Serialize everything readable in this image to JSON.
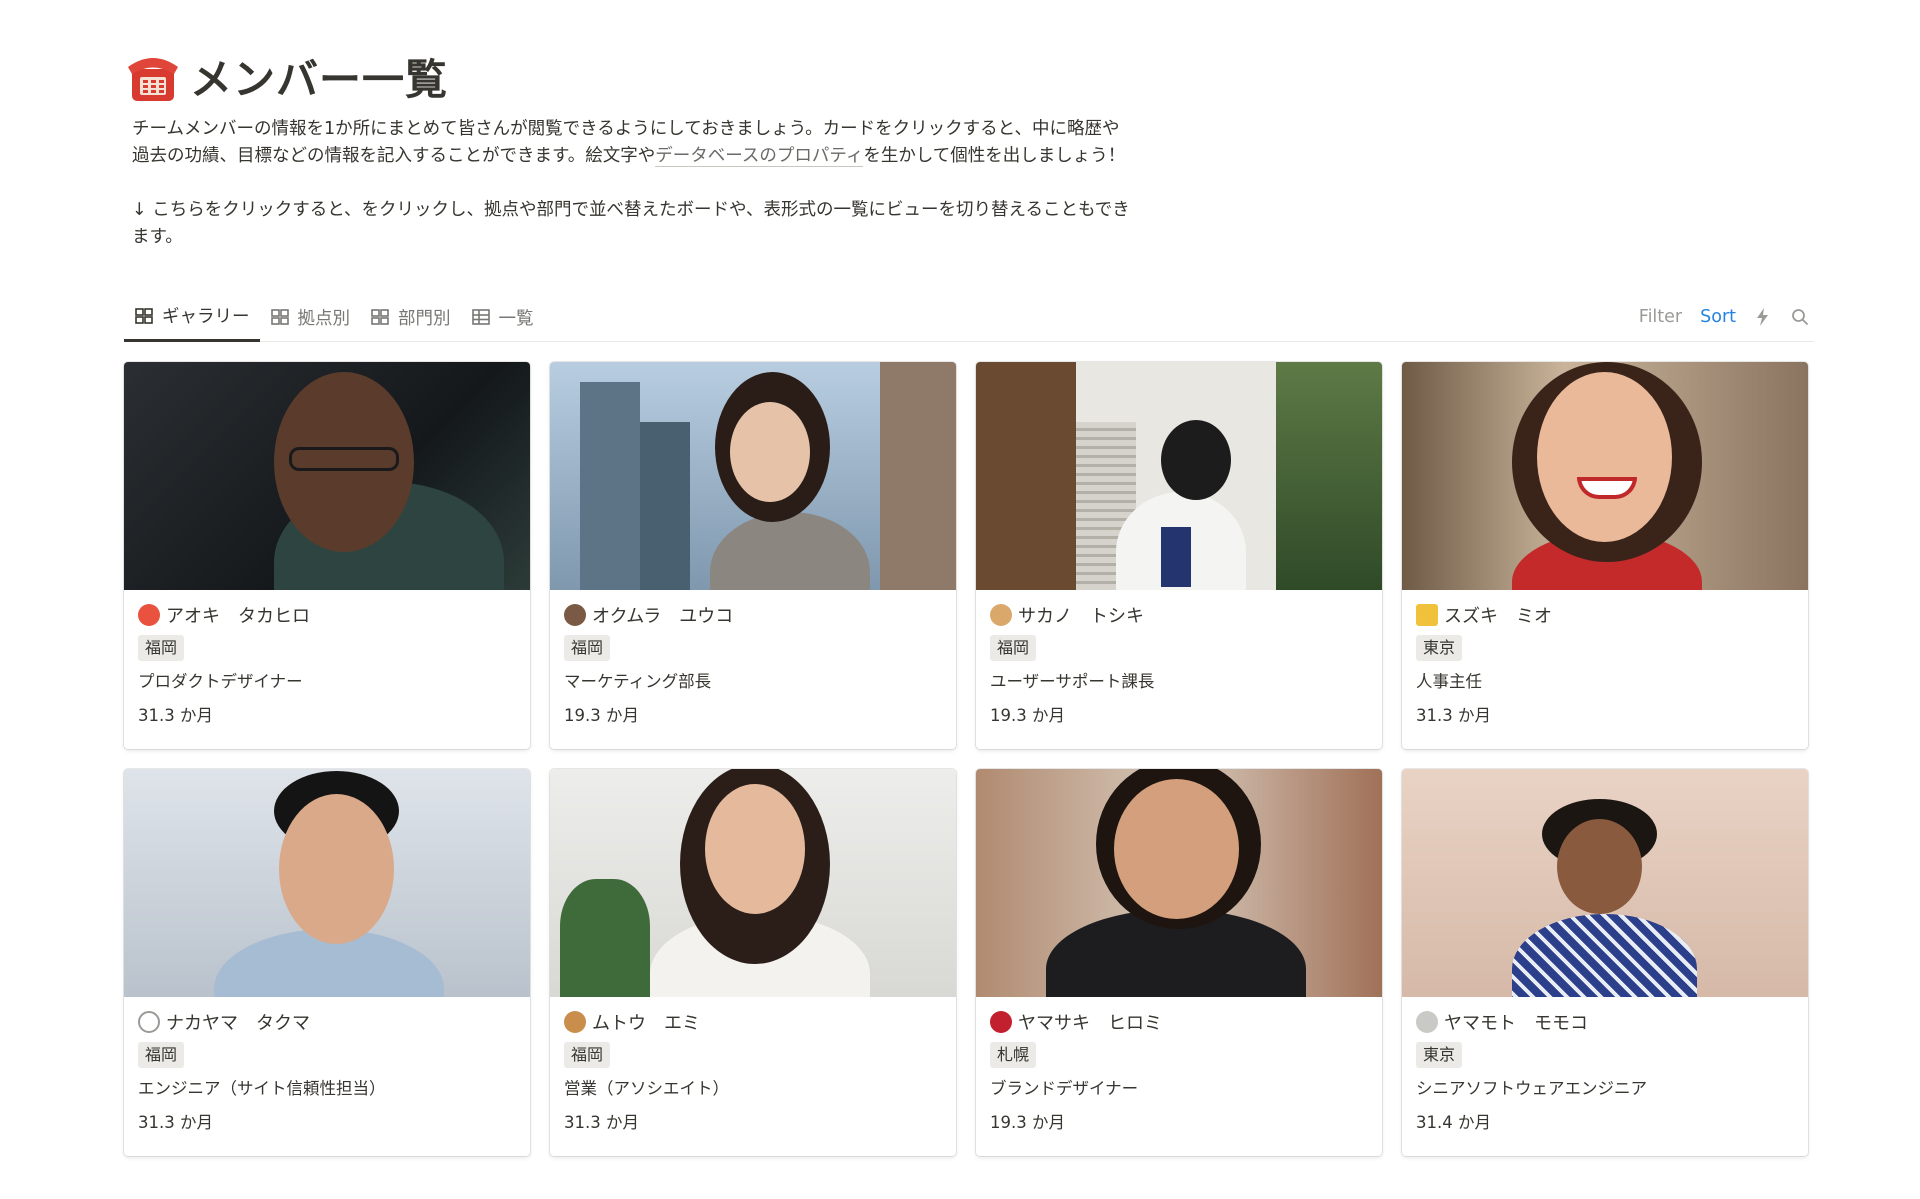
{
  "page": {
    "icon": "telephone-icon",
    "title": "メンバー一覧",
    "description_1_before": "チームメンバーの情報を1か所にまとめて皆さんが閲覧できるようにしておきましょう。カードをクリックすると、中に略歴や過去の功績、目標などの情報を記入することができます。絵文字や",
    "description_1_link": "データベースのプロパティ",
    "description_1_after": "を生かして個性を出しましょう！",
    "description_2": "↓ こちらをクリックすると、をクリックし、拠点や部門で並べ替えたボードや、表形式の一覧にビューを切り替えることもできます。"
  },
  "views": {
    "tabs": [
      {
        "label": "ギャラリー",
        "icon": "gallery-icon",
        "active": true
      },
      {
        "label": "拠点別",
        "icon": "gallery-icon",
        "active": false
      },
      {
        "label": "部門別",
        "icon": "gallery-icon",
        "active": false
      },
      {
        "label": "一覧",
        "icon": "table-icon",
        "active": false
      }
    ],
    "filter_label": "Filter",
    "sort_label": "Sort",
    "automation_icon": "lightning-icon",
    "search_icon": "search-icon"
  },
  "members": [
    {
      "emoji": "ping-pong-icon",
      "name": "アオキ　タカヒロ",
      "location": "福岡",
      "role": "プロダクトデザイナー",
      "tenure": "31.3 か月"
    },
    {
      "emoji": "bear-icon",
      "name": "オクムラ　ユウコ",
      "location": "福岡",
      "role": "マーケティング部長",
      "tenure": "19.3 か月"
    },
    {
      "emoji": "dog-icon",
      "name": "サカノ　トシキ",
      "location": "福岡",
      "role": "ユーザーサポート課長",
      "tenure": "19.3 か月"
    },
    {
      "emoji": "crown-icon",
      "name": "スズキ　ミオ",
      "location": "東京",
      "role": "人事主任",
      "tenure": "31.3 か月"
    },
    {
      "emoji": "headphones-icon",
      "name": "ナカヤマ　タクマ",
      "location": "福岡",
      "role": "エンジニア（サイト信頼性担当）",
      "tenure": "31.3 か月"
    },
    {
      "emoji": "cookie-icon",
      "name": "ムトウ　エミ",
      "location": "福岡",
      "role": "営業（アソシエイト）",
      "tenure": "31.3 か月"
    },
    {
      "emoji": "rose-icon",
      "name": "ヤマサキ　ヒロミ",
      "location": "札幌",
      "role": "ブランドデザイナー",
      "tenure": "19.3 か月"
    },
    {
      "emoji": "moon-icon",
      "name": "ヤマモト　モモコ",
      "location": "東京",
      "role": "シニアソフトウェアエンジニア",
      "tenure": "31.4 か月"
    }
  ]
}
